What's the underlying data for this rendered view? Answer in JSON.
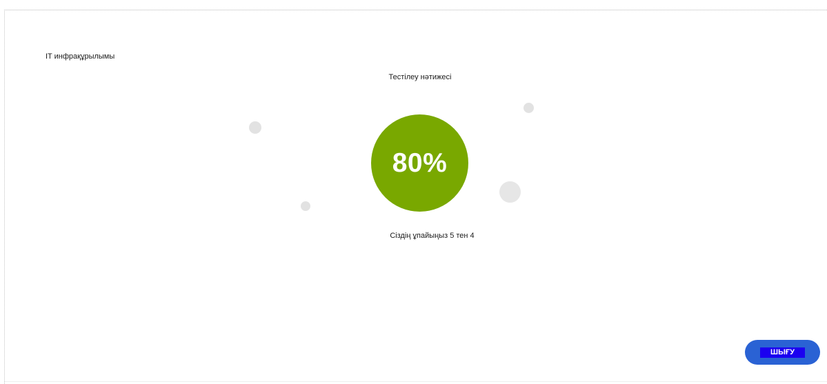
{
  "course": {
    "title": "IT инфрақұрылымы"
  },
  "result": {
    "heading": "Тестілеу нәтижесі",
    "score_percent_label": "80%",
    "score_percent": 80,
    "summary": "Сіздің ұпайыңыз 5 тен 4"
  },
  "actions": {
    "exit_label": "ШЫҒУ"
  },
  "colors": {
    "score_circle": "#79a800",
    "exit_button_bg": "#2a62d4",
    "exit_label_bg": "#1b00f0",
    "decor_dot": "#e2e2e2"
  },
  "icons": {
    "decor": "decorative-dot"
  }
}
